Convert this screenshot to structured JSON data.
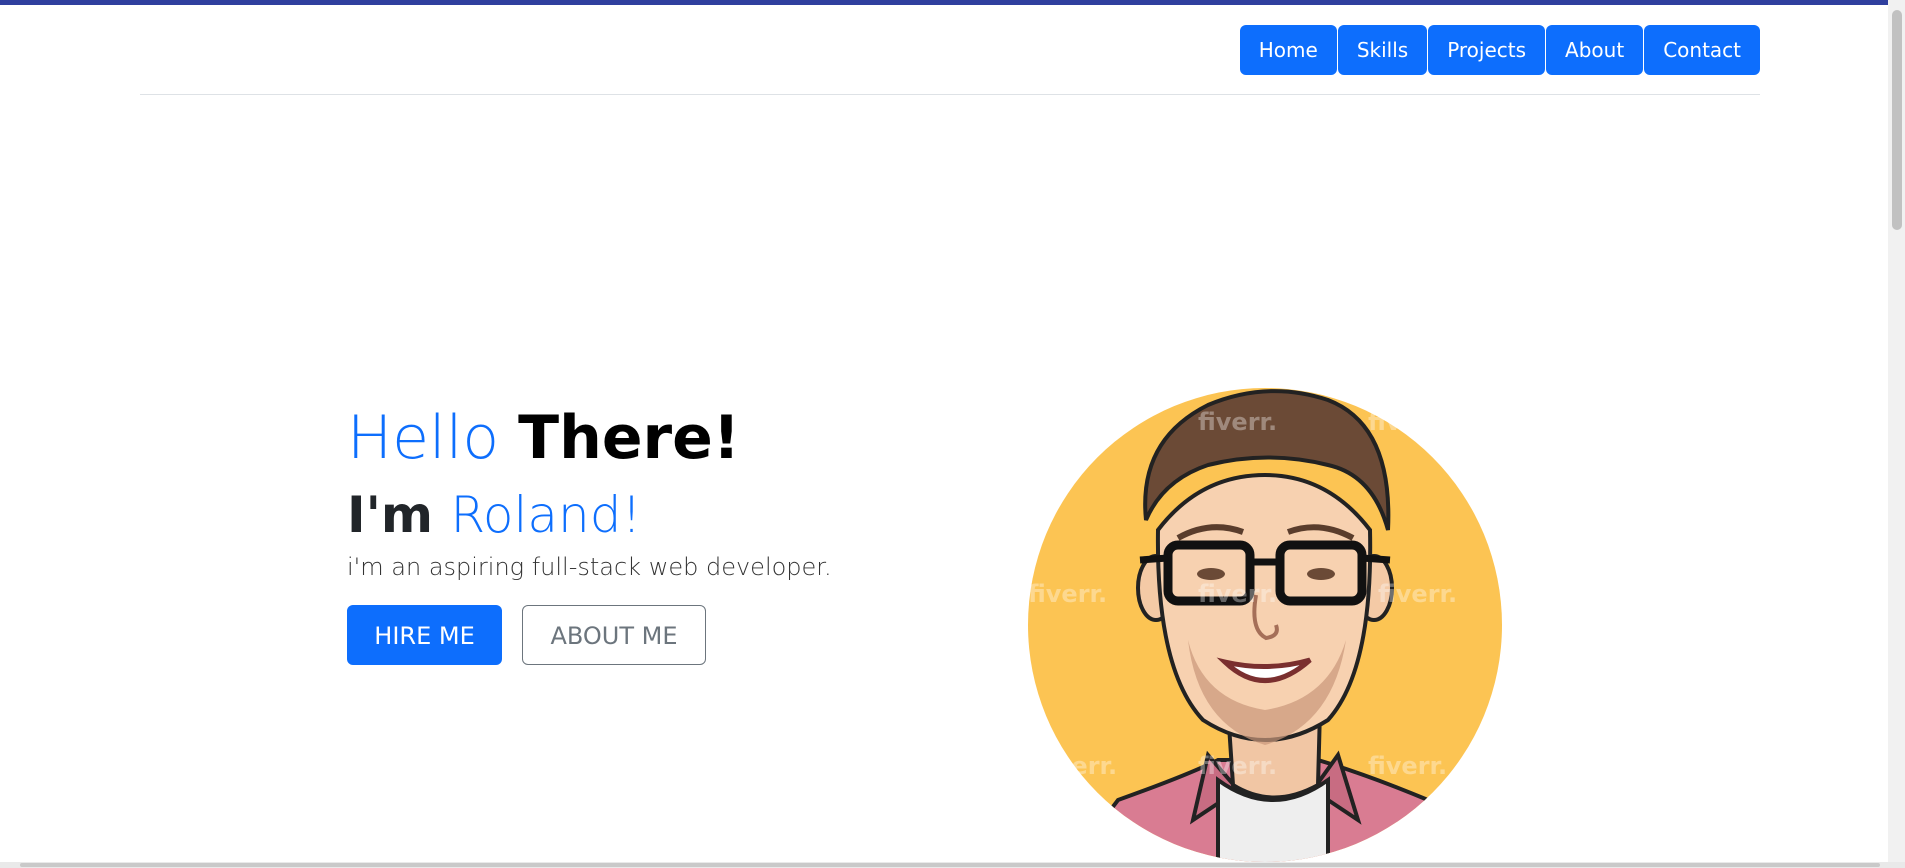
{
  "nav": {
    "items": [
      {
        "label": "Home"
      },
      {
        "label": "Skills"
      },
      {
        "label": "Projects"
      },
      {
        "label": "About"
      },
      {
        "label": "Contact"
      }
    ]
  },
  "hero": {
    "hello": "Hello",
    "there": "There!",
    "im": "I'm",
    "name": "Roland!",
    "tagline": "i'm an aspiring full-stack web developer.",
    "hire_label": "HIRE ME",
    "about_label": "ABOUT ME"
  },
  "avatar": {
    "watermark": "fiverr.",
    "colors": {
      "circle": "#fcc453",
      "shirt": "#d97c92",
      "hair": "#6b4a36"
    }
  },
  "colors": {
    "accent": "#0d6efd",
    "top_bar": "#2f3f9e"
  }
}
